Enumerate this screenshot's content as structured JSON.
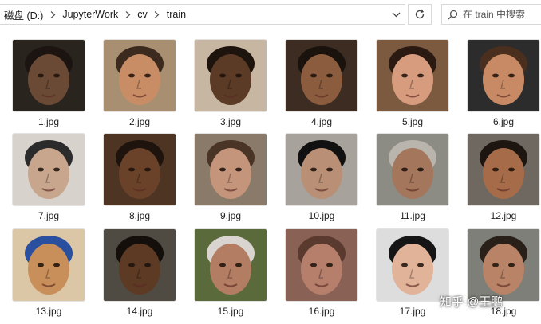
{
  "breadcrumb": {
    "items": [
      "磁盘 (D:)",
      "JupyterWork",
      "cv",
      "train"
    ],
    "separator_icon": "chevron-right-icon"
  },
  "search": {
    "placeholder": "在 train 中搜索"
  },
  "files": [
    {
      "name": "1.jpg",
      "skin": "#6b4a35",
      "bg": "#2a241f",
      "hair": "#1b1410"
    },
    {
      "name": "2.jpg",
      "skin": "#c98d66",
      "bg": "#a98f72",
      "hair": "#3b2a1d"
    },
    {
      "name": "3.jpg",
      "skin": "#5b3a26",
      "bg": "#c7b6a2",
      "hair": "#1e140e"
    },
    {
      "name": "4.jpg",
      "skin": "#8c5c3e",
      "bg": "#3d2c22",
      "hair": "#1a120d"
    },
    {
      "name": "5.jpg",
      "skin": "#d79c7e",
      "bg": "#7b5a3f",
      "hair": "#2a1a12"
    },
    {
      "name": "6.jpg",
      "skin": "#c88a64",
      "bg": "#2c2c2c",
      "hair": "#4a2f1f"
    },
    {
      "name": "7.jpg",
      "skin": "#c8a58d",
      "bg": "#d7d2cc",
      "hair": "#2b2b2b"
    },
    {
      "name": "8.jpg",
      "skin": "#6a4229",
      "bg": "#4e3423",
      "hair": "#1f140d"
    },
    {
      "name": "9.jpg",
      "skin": "#c4957b",
      "bg": "#8a7a6a",
      "hair": "#4a3426"
    },
    {
      "name": "10.jpg",
      "skin": "#b98f75",
      "bg": "#a7a39c",
      "hair": "#111111"
    },
    {
      "name": "11.jpg",
      "skin": "#a4765c",
      "bg": "#8c8c84",
      "hair": "#b9b4ac"
    },
    {
      "name": "12.jpg",
      "skin": "#a66b48",
      "bg": "#6e6860",
      "hair": "#1c1510"
    },
    {
      "name": "13.jpg",
      "skin": "#c98f5a",
      "bg": "#dbc6a6",
      "hair": "#2a4f9e"
    },
    {
      "name": "14.jpg",
      "skin": "#5c3a24",
      "bg": "#4f4a42",
      "hair": "#150f0b"
    },
    {
      "name": "15.jpg",
      "skin": "#b27d62",
      "bg": "#5b6a3a",
      "hair": "#d9d4cf"
    },
    {
      "name": "16.jpg",
      "skin": "#b57f6c",
      "bg": "#8a6255",
      "hair": "#5a3a2e"
    },
    {
      "name": "17.jpg",
      "skin": "#e1b49a",
      "bg": "#dddddd",
      "hair": "#151515"
    },
    {
      "name": "18.jpg",
      "skin": "#b88366",
      "bg": "#7f7f7a",
      "hair": "#2a201a"
    }
  ],
  "watermark": "知乎 @王鹏"
}
